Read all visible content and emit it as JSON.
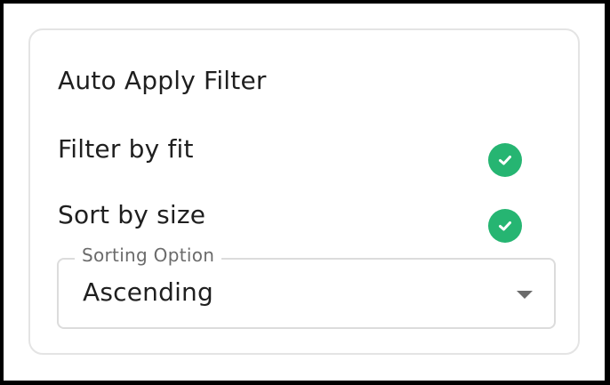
{
  "card": {
    "title": "Auto Apply Filter",
    "filter_by_fit": {
      "label": "Filter by fit",
      "checked": true,
      "icon": "check-circle-icon",
      "color": "#26b572"
    },
    "sort_by_size": {
      "label": "Sort by size",
      "checked": true,
      "icon": "check-circle-icon",
      "color": "#26b572"
    },
    "sorting_option": {
      "label": "Sorting Option",
      "value": "Ascending",
      "icon": "chevron-down-icon"
    }
  }
}
